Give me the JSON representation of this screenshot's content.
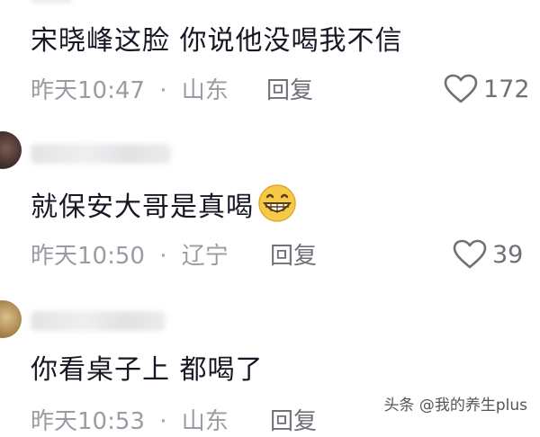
{
  "comments": [
    {
      "text": "宋晓峰这脸 你说他没喝我不信",
      "time": "昨天10:47",
      "location": "山东",
      "reply_label": "回复",
      "likes": "172"
    },
    {
      "text": "就保安大哥是真喝",
      "time": "昨天10:50",
      "location": "辽宁",
      "reply_label": "回复",
      "likes": "39"
    },
    {
      "text": "你看桌子上 都喝了",
      "time": "昨天10:53",
      "location": "山东",
      "reply_label": "回复"
    }
  ],
  "separator": "·",
  "watermark": "头条 @我的养生plus",
  "colors": {
    "text": "#161823",
    "meta": "#9a9ca3",
    "action": "#6f7178",
    "emoji": "#f7c948"
  },
  "icons": [
    "heart-icon",
    "grin-emoji-icon"
  ]
}
